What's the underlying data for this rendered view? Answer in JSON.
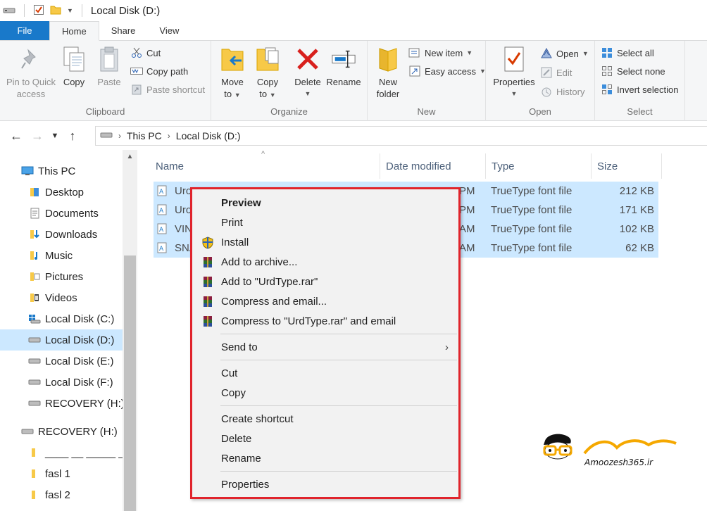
{
  "window": {
    "title": "Local Disk (D:)"
  },
  "tabs": [
    {
      "label": "File"
    },
    {
      "label": "Home"
    },
    {
      "label": "Share"
    },
    {
      "label": "View"
    }
  ],
  "ribbon": {
    "clipboard": {
      "label": "Clipboard",
      "pin": "Pin to Quick access",
      "pin_l1": "Pin to Quick",
      "pin_l2": "access",
      "copy": "Copy",
      "paste": "Paste",
      "cut": "Cut",
      "copy_path": "Copy path",
      "paste_shortcut": "Paste shortcut"
    },
    "organize": {
      "label": "Organize",
      "move_l1": "Move",
      "move_l2": "to",
      "copy_l1": "Copy",
      "copy_l2": "to",
      "delete": "Delete",
      "rename": "Rename"
    },
    "new": {
      "label": "New",
      "folder_l1": "New",
      "folder_l2": "folder",
      "new_item": "New item",
      "easy_access": "Easy access"
    },
    "open": {
      "label": "Open",
      "properties": "Properties",
      "open": "Open",
      "edit": "Edit",
      "history": "History"
    },
    "select": {
      "label": "Select",
      "select_all": "Select all",
      "select_none": "Select none",
      "invert": "Invert selection"
    }
  },
  "address": {
    "parts": [
      "This PC",
      "Local Disk (D:)"
    ]
  },
  "nav": {
    "items": [
      {
        "label": "This PC",
        "icon": "computer-icon"
      },
      {
        "label": "Desktop",
        "icon": "folder-icon"
      },
      {
        "label": "Documents",
        "icon": "documents-icon"
      },
      {
        "label": "Downloads",
        "icon": "downloads-icon"
      },
      {
        "label": "Music",
        "icon": "music-icon"
      },
      {
        "label": "Pictures",
        "icon": "pictures-icon"
      },
      {
        "label": "Videos",
        "icon": "videos-icon"
      },
      {
        "label": "Local Disk (C:)",
        "icon": "windows-drive-icon"
      },
      {
        "label": "Local Disk (D:)",
        "icon": "drive-icon"
      },
      {
        "label": "Local Disk (E:)",
        "icon": "drive-icon"
      },
      {
        "label": "Local Disk (F:)",
        "icon": "drive-icon"
      },
      {
        "label": "RECOVERY (H:)",
        "icon": "drive-icon"
      },
      {
        "label": "RECOVERY (H:)",
        "icon": "drive-icon"
      },
      {
        "label": "____ __ _____ _",
        "icon": "folder-icon"
      },
      {
        "label": "fasl 1",
        "icon": "folder-icon"
      },
      {
        "label": "fasl 2",
        "icon": "folder-icon"
      }
    ]
  },
  "files": {
    "columns": {
      "name": "Name",
      "date": "Date modified",
      "type": "Type",
      "size": "Size"
    },
    "rows": [
      {
        "name": "Uro",
        "date": "PM",
        "type": "TrueType font file",
        "size": "212 KB"
      },
      {
        "name": "Uro",
        "date": "PM",
        "type": "TrueType font file",
        "size": "171 KB"
      },
      {
        "name": "VIN",
        "date": "AM",
        "type": "TrueType font file",
        "size": "102 KB"
      },
      {
        "name": "SNA",
        "date": "AM",
        "type": "TrueType font file",
        "size": "62 KB"
      }
    ]
  },
  "context_menu": {
    "preview": "Preview",
    "print": "Print",
    "install": "Install",
    "add_archive": "Add to archive...",
    "add_rar": "Add to \"UrdType.rar\"",
    "compress_email": "Compress and email...",
    "compress_rar_email": "Compress to \"UrdType.rar\" and email",
    "send_to": "Send to",
    "cut": "Cut",
    "copy": "Copy",
    "create_shortcut": "Create shortcut",
    "delete": "Delete",
    "rename": "Rename",
    "properties": "Properties"
  },
  "watermark": {
    "text": "Amoozesh365.ir"
  },
  "colors": {
    "accent": "#1979ca",
    "selection": "#cce8ff",
    "highlight_border": "#e0242c"
  }
}
